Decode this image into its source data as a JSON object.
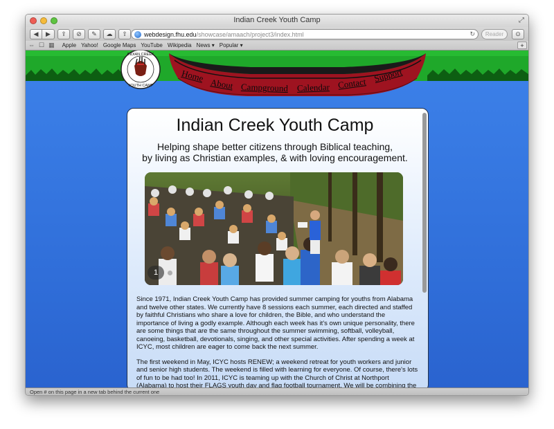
{
  "window": {
    "title": "Indian Creek Youth Camp"
  },
  "toolbar": {
    "url_host": "webdesign.fhu.edu",
    "url_path": "/showcase/amaach/project3/index.html",
    "reader_label": "Reader"
  },
  "bookmarks": [
    {
      "label": "Apple"
    },
    {
      "label": "Yahoo!"
    },
    {
      "label": "Google Maps"
    },
    {
      "label": "YouTube"
    },
    {
      "label": "Wikipedia"
    },
    {
      "label": "News ▾"
    },
    {
      "label": "Popular ▾"
    }
  ],
  "logo": {
    "text": "INDIAN CREEK YOUTH CAMP"
  },
  "nav": [
    {
      "label": "Home"
    },
    {
      "label": "About"
    },
    {
      "label": "Campground"
    },
    {
      "label": "Calendar"
    },
    {
      "label": "Contact"
    },
    {
      "label": "Support"
    }
  ],
  "page": {
    "heading": "Indian Creek Youth Camp",
    "tagline_line1": "Helping shape better citizens through Biblical teaching,",
    "tagline_line2": "by living as Christian examples, & with loving encouragement.",
    "slide_number": "1",
    "paragraph1": "Since 1971, Indian Creek Youth Camp has provided summer camping for youths from Alabama and twelve other states. We currently have 8 sessions each summer, each directed and staffed by faithful Christians who share a love for children, the Bible, and who understand the importance of living a godly example. Although each week has it's own unique personality, there are some things that are the same throughout the summer swimming, softball, volleyball, canoeing, basketball, devotionals, singing, and other special activities. After spending a week at ICYC, most children are eager to come back the next summer.",
    "paragraph2": "The first weekend in May, ICYC hosts RENEW; a weekend retreat for youth workers and junior and senior high students. The weekend is filled with learning for everyone. Of course, there's lots of fun to be had too! In 2011, ICYC is teaming up with the Church of Christ at Northport (Alabama) to host their FLAGS youth day and flag football tournament. We will be combining the RENEW weekend with FLAGS. This will be an exciting weekend! Click the button on the left to find out more."
  },
  "status": {
    "text": "Open # on this page in a new tab behind the current one"
  },
  "colors": {
    "sky": "#3d82ea",
    "grass": "#1fa82a",
    "canoe": "#9e1320",
    "panel_border": "#20304a"
  }
}
